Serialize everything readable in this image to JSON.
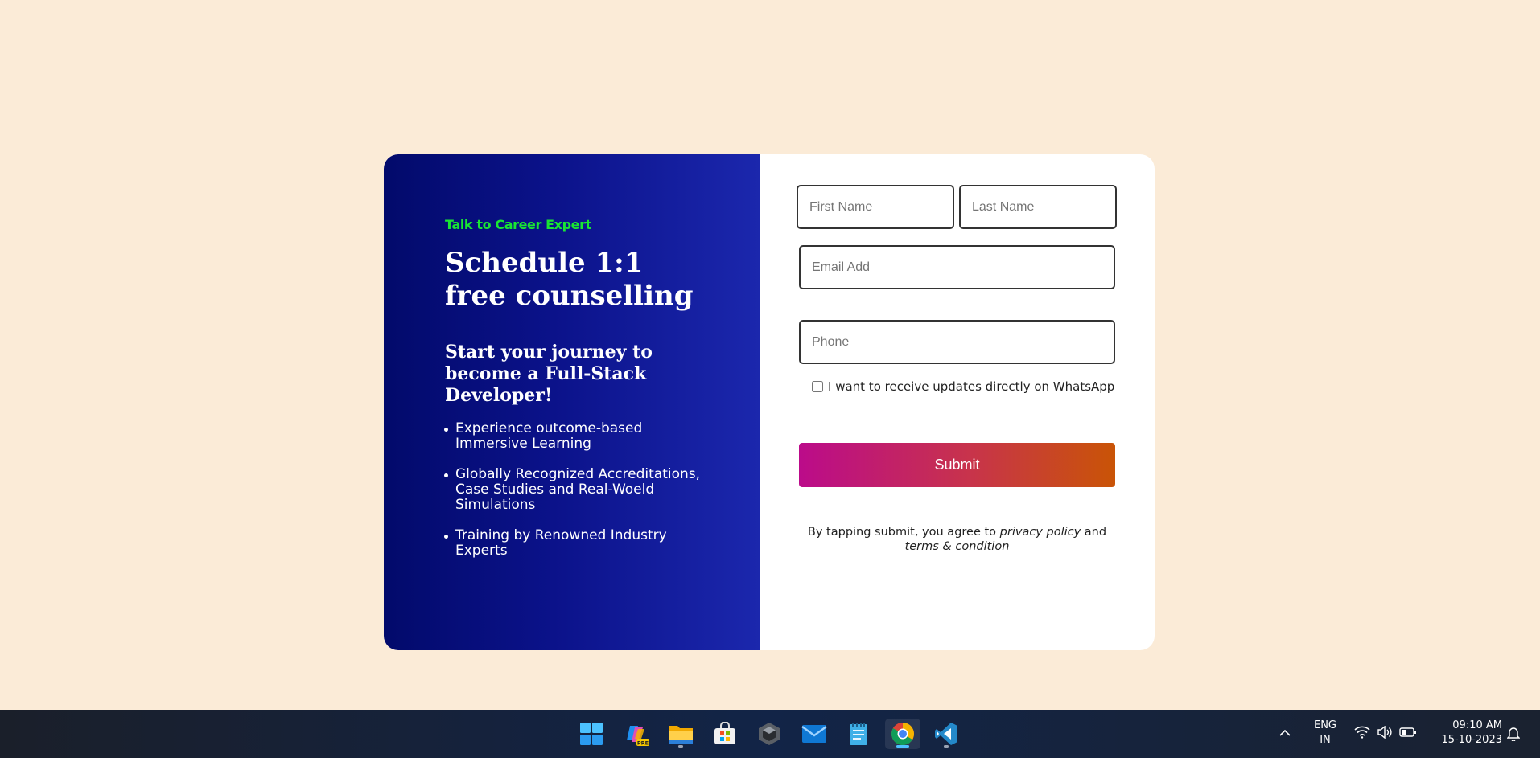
{
  "promo": {
    "eyebrow": "Talk to Career Expert",
    "headline": "Schedule 1:1 free counselling",
    "subhead": "Start your journey to become a Full-Stack Developer!",
    "bullets": [
      "Experience outcome-based Immersive Learning",
      "Globally Recognized Accreditations, Case Studies and Real-Woeld Simulations",
      "Training by Renowned Industry Experts"
    ]
  },
  "form": {
    "first_name_placeholder": "First Name",
    "last_name_placeholder": "Last Name",
    "email_placeholder": "Email Add",
    "phone_placeholder": "Phone",
    "whatsapp_label": "I want to receive updates directly on WhatsApp",
    "whatsapp_checked": false,
    "submit_label": "Submit",
    "legal_prefix": "By tapping submit, you agree to",
    "privacy_link": "privacy policy",
    "legal_and": "and",
    "terms_link": "terms & condition"
  },
  "colors": {
    "page_bg": "#fbebd7",
    "promo_gradient_start": "#020a6b",
    "promo_gradient_end": "#1b27ad",
    "eyebrow": "#19e632",
    "submit_gradient_start": "#bb0b8a",
    "submit_gradient_end": "#c95406"
  },
  "taskbar": {
    "apps": [
      {
        "name": "start-icon"
      },
      {
        "name": "copilot-icon",
        "badge": "PRE"
      },
      {
        "name": "file-explorer-icon"
      },
      {
        "name": "microsoft-store-icon"
      },
      {
        "name": "app-cube-icon"
      },
      {
        "name": "mail-icon"
      },
      {
        "name": "notepad-icon"
      },
      {
        "name": "chrome-icon"
      },
      {
        "name": "vscode-icon"
      }
    ],
    "language_line1": "ENG",
    "language_line2": "IN",
    "time": "09:10 AM",
    "date": "15-10-2023"
  }
}
